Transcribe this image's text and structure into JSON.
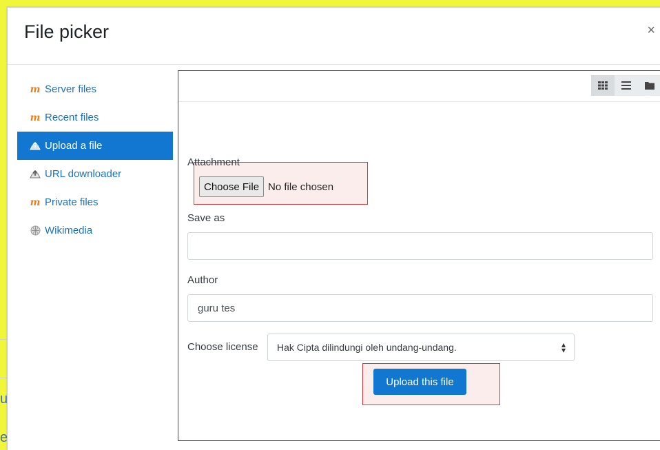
{
  "background": {
    "glyph_u": "u",
    "glyph_e": "e"
  },
  "modal": {
    "title": "File picker",
    "close_glyph": "×"
  },
  "sidebar": {
    "items": [
      {
        "label": "Server files",
        "icon": "moodle-icon",
        "active": false
      },
      {
        "label": "Recent files",
        "icon": "moodle-icon",
        "active": false
      },
      {
        "label": "Upload a file",
        "icon": "upload-icon",
        "active": true
      },
      {
        "label": "URL downloader",
        "icon": "url-download-icon",
        "active": false
      },
      {
        "label": "Private files",
        "icon": "moodle-icon",
        "active": false
      },
      {
        "label": "Wikimedia",
        "icon": "wikimedia-icon",
        "active": false
      }
    ]
  },
  "toolbar": {
    "views": [
      "grid-view-icon",
      "list-view-icon",
      "tree-view-icon"
    ]
  },
  "form": {
    "attachment_label": "Attachment",
    "choose_file_label": "Choose File",
    "no_file_text": "No file chosen",
    "save_as_label": "Save as",
    "save_as_value": "",
    "author_label": "Author",
    "author_value": "guru tes",
    "license_label": "Choose license",
    "license_value": "Hak Cipta dilindungi oleh undang-undang.",
    "upload_label": "Upload this file"
  },
  "colors": {
    "accent": "#1177d1",
    "background": "#f0f63a",
    "highlight": "#d9363e"
  }
}
